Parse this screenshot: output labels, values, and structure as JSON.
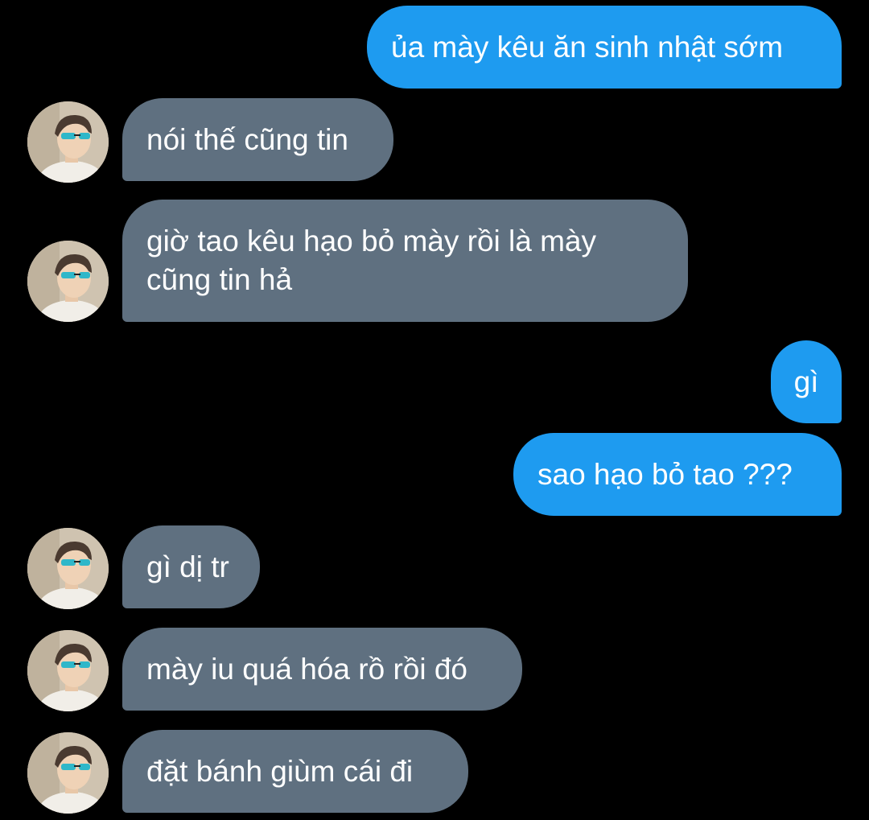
{
  "theme": {
    "background": "#000000",
    "sent_bubble_color": "#1e9bf0",
    "received_bubble_color": "#5f7080",
    "text_color": "#ffffff"
  },
  "messages": [
    {
      "direction": "sent",
      "text": "ủa mày kêu ăn sinh nhật sớm"
    },
    {
      "direction": "received",
      "text": "nói thế cũng tin",
      "avatar": "user-avatar"
    },
    {
      "direction": "received",
      "text": "giờ tao kêu hạo bỏ mày rồi là mày cũng tin hả",
      "avatar": "user-avatar"
    },
    {
      "direction": "sent",
      "text": "gì"
    },
    {
      "direction": "sent",
      "text": "sao hạo bỏ tao ???"
    },
    {
      "direction": "received",
      "text": "gì dị tr",
      "avatar": "user-avatar"
    },
    {
      "direction": "received",
      "text": "mày iu quá hóa rồ rồi đó",
      "avatar": "user-avatar"
    },
    {
      "direction": "received",
      "text": "đặt bánh giùm cái đi",
      "avatar": "user-avatar"
    }
  ]
}
